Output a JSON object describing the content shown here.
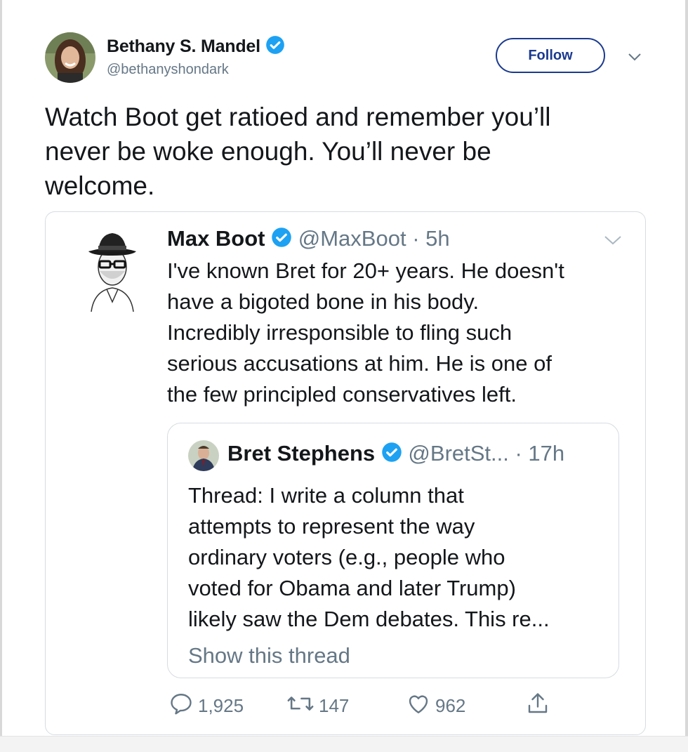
{
  "author": {
    "name": "Bethany S. Mandel",
    "handle": "@bethanyshondark",
    "follow_label": "Follow"
  },
  "tweet": {
    "text": "Watch Boot get ratioed and remember you’ll\nnever be woke enough. You’ll never be\nwelcome."
  },
  "quoted": {
    "name": "Max Boot",
    "handle": "@MaxBoot",
    "time": "· 5h",
    "text": "I've known Bret for 20+ years. He doesn't\nhave a bigoted bone in his body.\nIncredibly irresponsible to fling such\nserious accusations at him. He is one of\nthe few principled conservatives left.",
    "nested": {
      "name": "Bret Stephens",
      "handle": "@BretSt...",
      "time": "· 17h",
      "text": "Thread: I write a column that\nattempts to represent the way\nordinary voters (e.g., people who\nvoted for Obama and later Trump)\nlikely saw the Dem debates. This re...",
      "show_thread": "Show this thread"
    },
    "actions": {
      "replies": "1,925",
      "retweets": "147",
      "likes": "962"
    }
  },
  "colors": {
    "verified": "#1da1f2",
    "follow_border": "#1b3a8f",
    "muted": "#657786",
    "border": "#d6dce1"
  },
  "icons": [
    "verified-icon",
    "chevron-down-icon",
    "reply-icon",
    "retweet-icon",
    "like-icon",
    "share-icon"
  ]
}
